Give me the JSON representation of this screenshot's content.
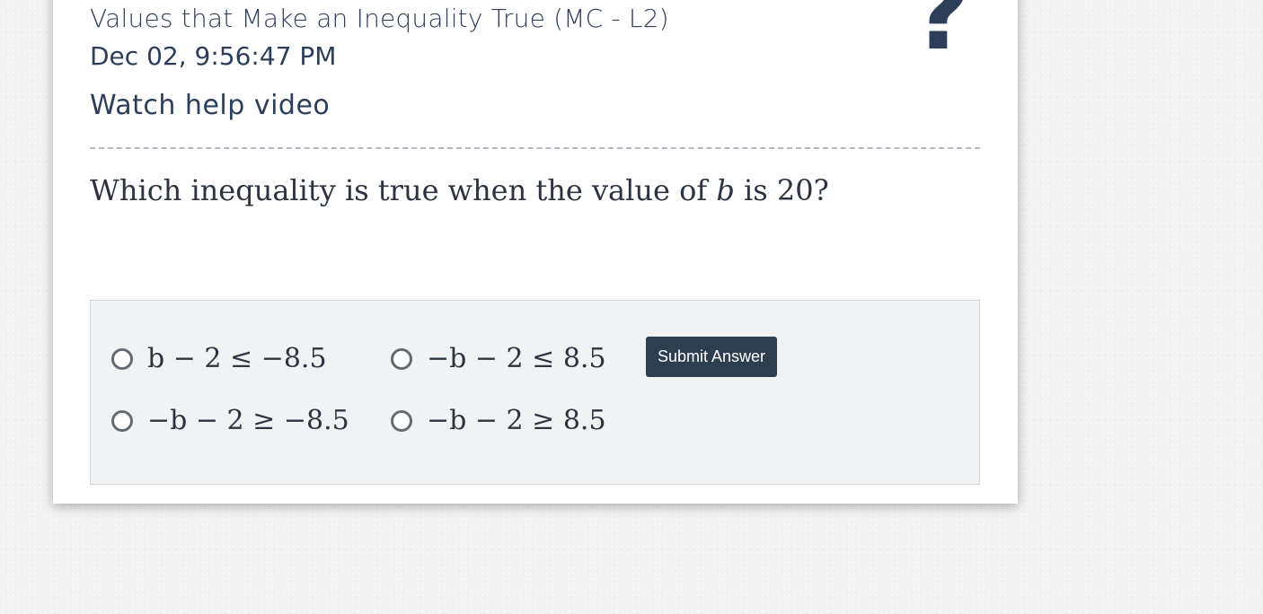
{
  "header": {
    "title": "Values that Make an Inequality True (MC - L2)",
    "timestamp": "Dec 02, 9:56:47 PM",
    "help_link": "Watch help video",
    "help_icon": "question-mark-icon",
    "help_icon_glyph": "?"
  },
  "question": {
    "prefix": "Which inequality is true when the value of ",
    "variable": "b",
    "middle": " is ",
    "value": "20",
    "suffix": "?"
  },
  "choices": [
    {
      "label": "b − 2 ≤ −8.5"
    },
    {
      "label": "−b − 2 ≤ 8.5"
    },
    {
      "label": "−b − 2 ≥ −8.5"
    },
    {
      "label": "−b − 2 ≥ 8.5"
    }
  ],
  "submit": {
    "label": "Submit Answer"
  },
  "colors": {
    "text_dark": "#2c3e5a",
    "button_bg": "#2c3e50",
    "panel_bg": "#f1f2f4"
  }
}
